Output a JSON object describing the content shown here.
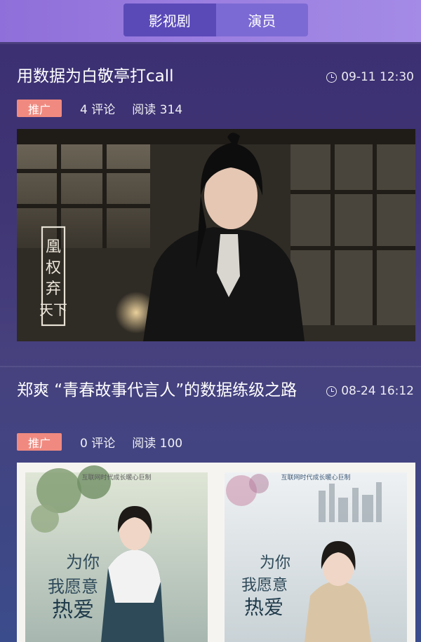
{
  "tabs": [
    {
      "label": "影视剧",
      "active": true
    },
    {
      "label": "演员",
      "active": false
    }
  ],
  "colors": {
    "badge": "#f08a80",
    "accent": "#9b7ee0"
  },
  "articles": [
    {
      "title": "用数据为白敬亭打call",
      "time": "09-11 12:30",
      "tag": "推广",
      "comments": "4 评论",
      "reads": "阅读 314",
      "image_text": "凰权弃天下"
    },
    {
      "title": "郑爽 “青春故事代言人”的数据练级之路",
      "time": "08-24 16:12",
      "tag": "推广",
      "comments": "0 评论",
      "reads": "阅读 100",
      "image_text": "互联网时代成长暖心巨制",
      "poster_title": "我为你 意热爱 整个世界",
      "poster_tag_left": "互联网时代成长暖心巨制",
      "poster_tag_right": "互联网时代成长暖心巨制"
    }
  ]
}
